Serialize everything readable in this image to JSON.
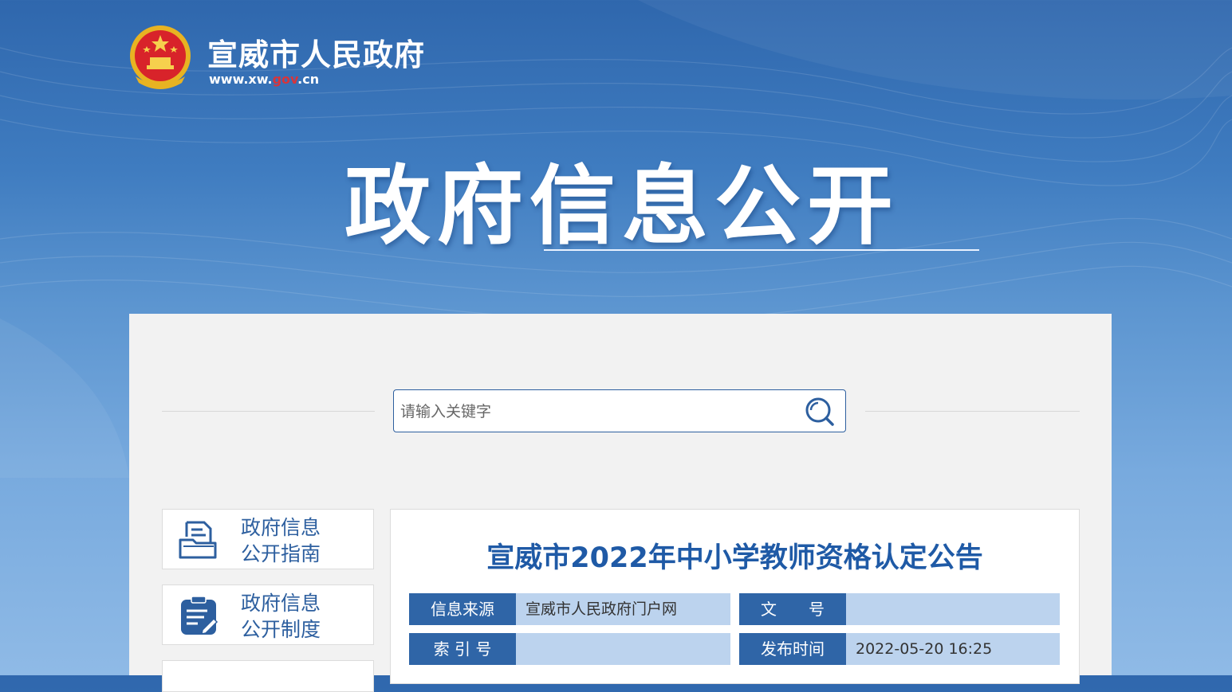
{
  "site": {
    "name": "宣威市人民政府",
    "url_prefix": "www.xw.",
    "url_highlight": "gov",
    "url_suffix": ".cn"
  },
  "banner": {
    "title": "政府信息公开"
  },
  "search": {
    "placeholder": "请输入关键字"
  },
  "sidebar": {
    "items": [
      {
        "line1": "政府信息",
        "line2": "公开指南",
        "icon": "document-folder-icon"
      },
      {
        "line1": "政府信息",
        "line2": "公开制度",
        "icon": "clipboard-edit-icon"
      }
    ]
  },
  "article": {
    "title": "宣威市2022年中小学教师资格认定公告",
    "meta": {
      "source_label": "信息来源",
      "source_value": "宣威市人民政府门户网",
      "doc_no_label": "文　　号",
      "doc_no_value": "",
      "index_label": "索 引 号",
      "index_value": "",
      "publish_label": "发布时间",
      "publish_value": "2022-05-20 16:25"
    }
  },
  "colors": {
    "primary": "#2f65a7",
    "meta_value_bg": "#bcd3ee",
    "title": "#1f5aa6",
    "url_highlight": "#d9343a"
  }
}
